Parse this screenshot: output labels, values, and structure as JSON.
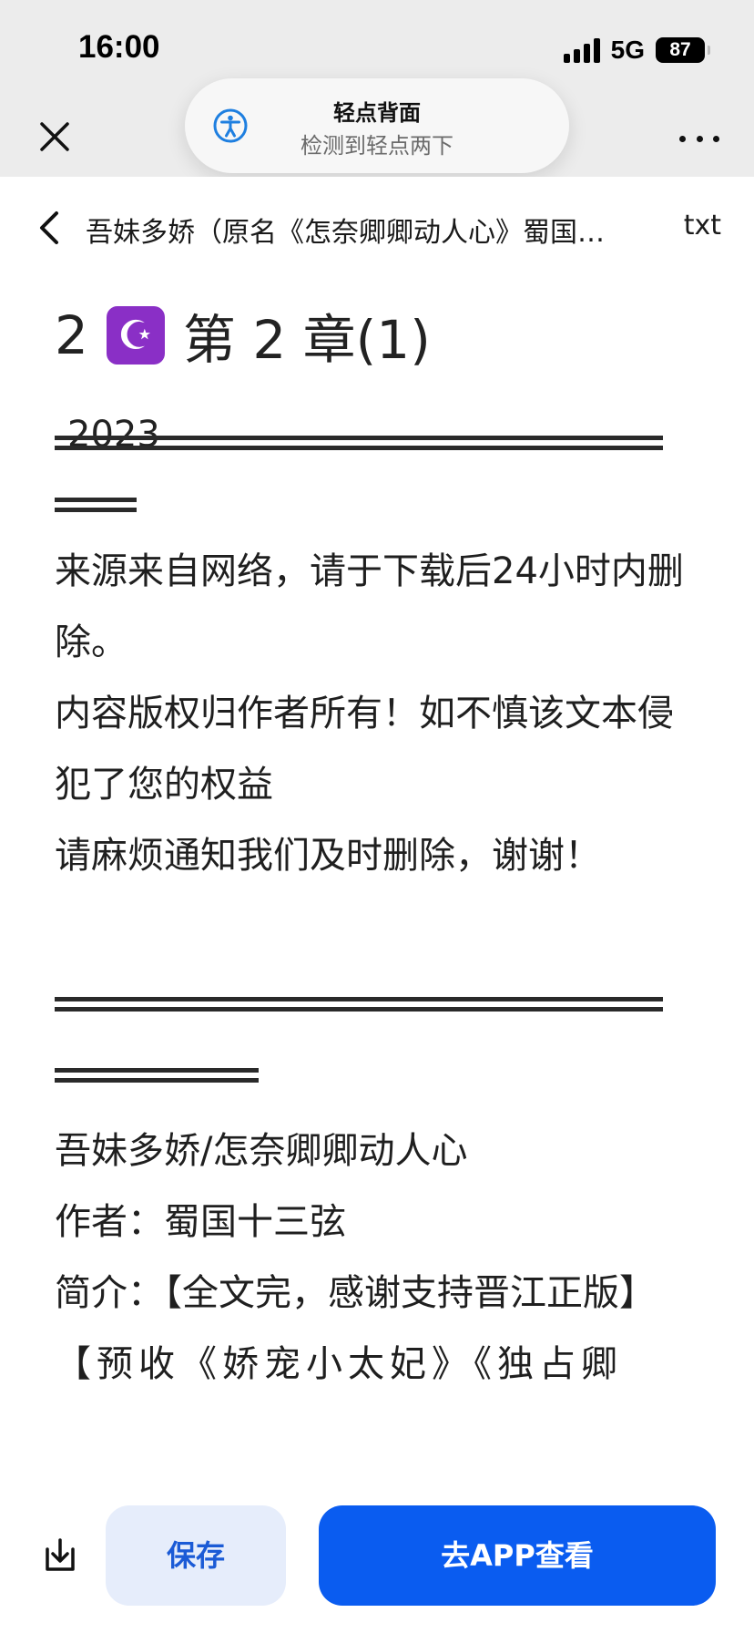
{
  "status": {
    "time": "16:00",
    "network": "5G",
    "battery": "87"
  },
  "toast": {
    "title": "轻点背面",
    "subtitle": "检测到轻点两下",
    "icon": "accessibility-icon"
  },
  "nav": {
    "title": "吾妹多娇（原名《怎奈卿卿动人心》蜀国…",
    "extension": "txt"
  },
  "content": {
    "chapter_number": "2",
    "badge_icon": "☪",
    "chapter_title": "第 2 章(1)",
    "year": "2023",
    "disclaimer": [
      "来源来自网络，请于下载后24小时内删除。",
      "内容版权归作者所有！如不慎该文本侵犯了您的权益",
      "请麻烦通知我们及时删除，谢谢！"
    ],
    "book_title": "吾妹多娇/怎奈卿卿动人心",
    "author_line": "作者：蜀国十三弦",
    "intro_line": "简介：【全文完，感谢支持晋江正版】",
    "preorder_line": "【预收《娇宠小太妃》《独占卿"
  },
  "bottom": {
    "save_label": "保存",
    "app_label": "去APP查看",
    "accent_color": "#0a5cf0"
  }
}
